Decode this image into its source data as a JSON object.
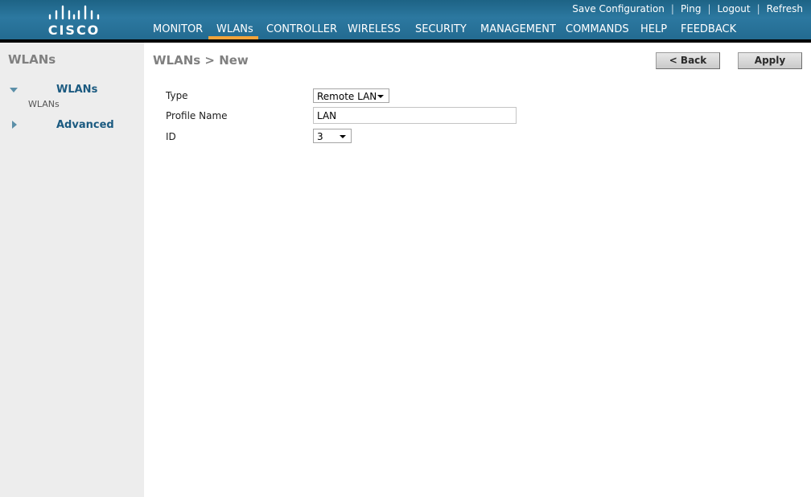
{
  "brand": {
    "logo_text": "CISCO"
  },
  "top_links": [
    "Save Configuration",
    "Ping",
    "Logout",
    "Refresh"
  ],
  "nav": {
    "items": [
      "MONITOR",
      "WLANs",
      "CONTROLLER",
      "WIRELESS",
      "SECURITY",
      "MANAGEMENT",
      "COMMANDS",
      "HELP",
      "FEEDBACK"
    ],
    "active": "WLANs"
  },
  "sidebar": {
    "title": "WLANs",
    "groups": [
      {
        "label": "WLANs",
        "expanded": true,
        "children": [
          "WLANs"
        ]
      },
      {
        "label": "Advanced",
        "expanded": false
      }
    ]
  },
  "page": {
    "title": "WLANs > New",
    "buttons": {
      "back": "< Back",
      "apply": "Apply"
    }
  },
  "form": {
    "type_label": "Type",
    "type_value": "Remote LAN",
    "profile_label": "Profile Name",
    "profile_value": "LAN",
    "id_label": "ID",
    "id_value": "3"
  },
  "colors": {
    "header": "#236b91",
    "accent": "#f3a43a",
    "sidebar_bg": "#ededed",
    "link": "#1b5a80"
  }
}
